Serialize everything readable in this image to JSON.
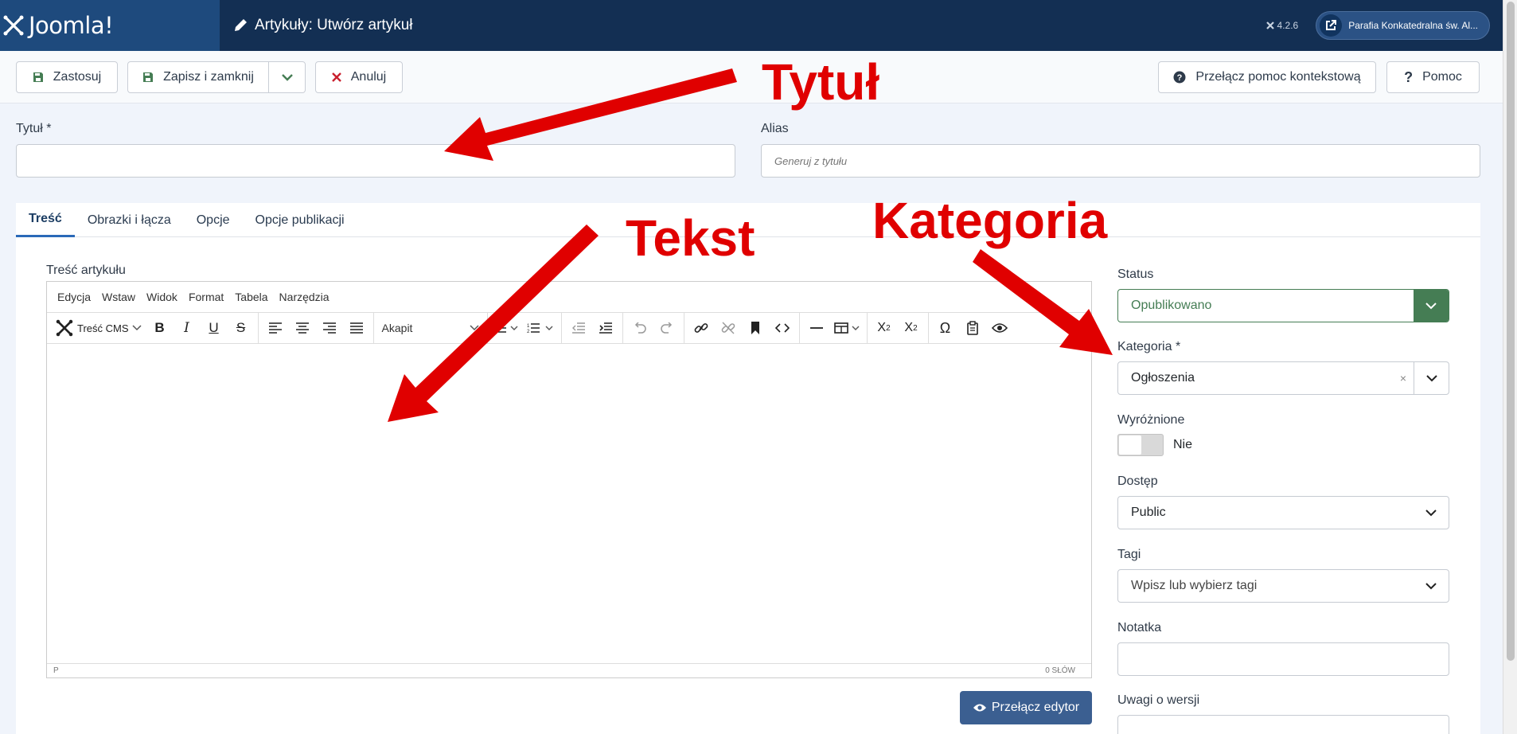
{
  "header": {
    "brand": "Joomla!",
    "title": "Artykuły: Utwórz artykuł",
    "version": "4.2.6",
    "site_button": "Parafia Konkatedralna św. Al..."
  },
  "toolbar": {
    "apply": "Zastosuj",
    "save_close": "Zapisz i zamknij",
    "cancel": "Anuluj",
    "toggle_help": "Przełącz pomoc kontekstową",
    "help": "Pomoc"
  },
  "fields": {
    "title_label": "Tytuł *",
    "title_value": "",
    "alias_label": "Alias",
    "alias_placeholder": "Generuj z tytułu"
  },
  "tabs": [
    {
      "label": "Treść"
    },
    {
      "label": "Obrazki i łącza"
    },
    {
      "label": "Opcje"
    },
    {
      "label": "Opcje publikacji"
    }
  ],
  "editor": {
    "label": "Treść artykułu",
    "menu": [
      "Edycja",
      "Wstaw",
      "Widok",
      "Format",
      "Tabela",
      "Narzędzia"
    ],
    "cms_select": "Treść CMS",
    "format_select": "Akapit",
    "path": "P",
    "word_count": "0 SŁÓW",
    "toggle_editor": "Przełącz edytor"
  },
  "sidebar": {
    "status_label": "Status",
    "status_value": "Opublikowano",
    "category_label": "Kategoria *",
    "category_value": "Ogłoszenia",
    "featured_label": "Wyróżnione",
    "featured_value": "Nie",
    "access_label": "Dostęp",
    "access_value": "Public",
    "tags_label": "Tagi",
    "tags_placeholder": "Wpisz lub wybierz tagi",
    "note_label": "Notatka",
    "version_note_label": "Uwagi o wersji"
  },
  "annotations": {
    "title": "Tytuł",
    "text": "Tekst",
    "category": "Kategoria",
    "color": "#e00000"
  },
  "colors": {
    "header_bg": "#132f53",
    "status_green": "#457d54",
    "primary_button": "#3b5f91"
  }
}
